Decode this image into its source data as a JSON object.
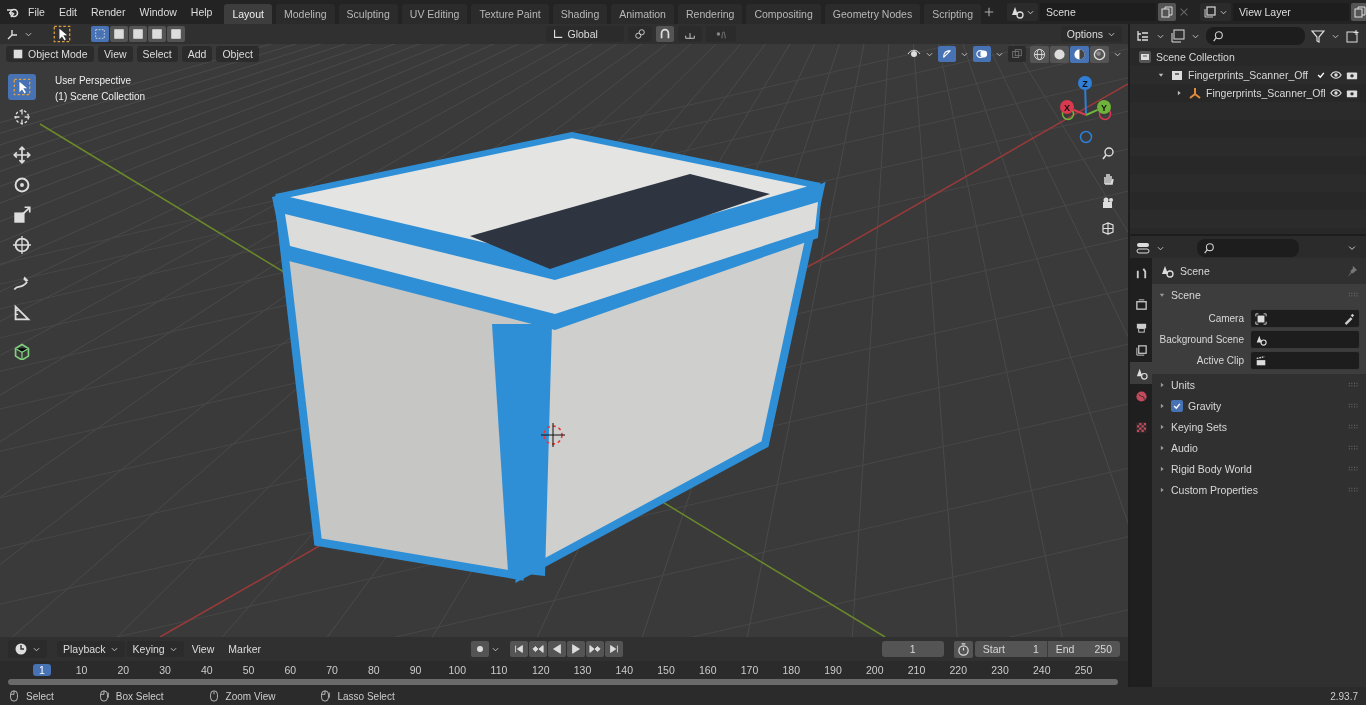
{
  "top_menu": [
    "File",
    "Edit",
    "Render",
    "Window",
    "Help"
  ],
  "workspaces": [
    {
      "label": "Layout",
      "selected": true
    },
    {
      "label": "Modeling",
      "selected": false
    },
    {
      "label": "Sculpting",
      "selected": false
    },
    {
      "label": "UV Editing",
      "selected": false
    },
    {
      "label": "Texture Paint",
      "selected": false
    },
    {
      "label": "Shading",
      "selected": false
    },
    {
      "label": "Animation",
      "selected": false
    },
    {
      "label": "Rendering",
      "selected": false
    },
    {
      "label": "Compositing",
      "selected": false
    },
    {
      "label": "Geometry Nodes",
      "selected": false
    },
    {
      "label": "Scripting",
      "selected": false
    }
  ],
  "scene_selector": {
    "value": "Scene"
  },
  "view_layer_selector": {
    "value": "View Layer"
  },
  "tool_header": {
    "proportional_edit_on": false,
    "select_modes": [
      {
        "selected": true
      },
      {
        "selected": false
      },
      {
        "selected": false
      },
      {
        "selected": false
      },
      {
        "selected": false
      }
    ],
    "orientation": "Global",
    "options": "Options"
  },
  "viewport_header": {
    "mode": "Object Mode",
    "menus": [
      "View",
      "Select",
      "Add",
      "Object"
    ],
    "gizmos_on": true,
    "overlays_on": true,
    "shading": [
      {
        "kind": "wireframe",
        "selected": false
      },
      {
        "kind": "solid",
        "selected": false
      },
      {
        "kind": "material",
        "selected": true
      },
      {
        "kind": "rendered",
        "selected": false
      }
    ]
  },
  "toolbar": [
    {
      "kind": "select",
      "selected": true
    },
    {
      "kind": "cursor",
      "selected": false
    },
    {
      "kind": "move",
      "selected": false
    },
    {
      "kind": "rotate",
      "selected": false
    },
    {
      "kind": "scale",
      "selected": false
    },
    {
      "kind": "transform",
      "selected": false
    },
    {
      "kind": "annotate",
      "selected": false
    },
    {
      "kind": "measure",
      "selected": false
    },
    {
      "kind": "add_cube",
      "selected": false
    }
  ],
  "viewport_overlay": {
    "perspective": "User Perspective",
    "collection": "(1) Scene Collection"
  },
  "gizmo_axes": [
    {
      "kind": "z",
      "label": "Z"
    },
    {
      "kind": "y",
      "label": "Y"
    },
    {
      "kind": "x",
      "label": "X"
    }
  ],
  "outliner": {
    "items": [
      {
        "kind": "scene_collection",
        "label": "Scene Collection",
        "children": [
          {
            "kind": "collection",
            "label": "Fingerprints_Scanner_Off",
            "expanded": true,
            "checked": true,
            "children": [
              {
                "kind": "object",
                "label": "Fingerprints_Scanner_Ofl",
                "expanded": false
              }
            ]
          }
        ]
      }
    ]
  },
  "properties": {
    "tabs": [
      {
        "kind": "tool",
        "selected": false
      },
      {
        "kind": "render",
        "selected": false
      },
      {
        "kind": "output",
        "selected": false
      },
      {
        "kind": "view_layer",
        "selected": false
      },
      {
        "kind": "scene",
        "selected": true
      },
      {
        "kind": "world",
        "selected": false
      },
      {
        "kind": "texture",
        "selected": false
      }
    ],
    "context": "Scene",
    "panels": [
      {
        "title": "Scene",
        "expanded": true,
        "fields": [
          {
            "label": "Camera",
            "kind": "camera"
          },
          {
            "label": "Background Scene",
            "kind": "scene"
          },
          {
            "label": "Active Clip",
            "kind": "clip"
          }
        ]
      },
      {
        "title": "Units",
        "expanded": false
      },
      {
        "title": "Gravity",
        "expanded": false,
        "checked": true
      },
      {
        "title": "Keying Sets",
        "expanded": false
      },
      {
        "title": "Audio",
        "expanded": false
      },
      {
        "title": "Rigid Body World",
        "expanded": false
      },
      {
        "title": "Custom Properties",
        "expanded": false
      }
    ]
  },
  "timeline": {
    "menus": [
      {
        "label": "Playback",
        "dropdown": true
      },
      {
        "label": "Keying",
        "dropdown": true
      },
      {
        "label": "View",
        "dropdown": false
      },
      {
        "label": "Marker",
        "dropdown": false
      }
    ],
    "current_frame": "1",
    "start_label": "Start",
    "start": "1",
    "end_label": "End",
    "end": "250",
    "ruler": [
      "1",
      "10",
      "20",
      "30",
      "40",
      "50",
      "60",
      "70",
      "80",
      "90",
      "100",
      "110",
      "120",
      "130",
      "140",
      "150",
      "160",
      "170",
      "180",
      "190",
      "200",
      "210",
      "220",
      "230",
      "240",
      "250"
    ]
  },
  "status_bar": {
    "hints": [
      {
        "kind": "left",
        "label": "Select"
      },
      {
        "kind": "drag",
        "label": "Box Select"
      },
      {
        "kind": "middle",
        "label": "Zoom View"
      },
      {
        "kind": "drag",
        "label": "Lasso Select"
      }
    ],
    "version": "2.93.7"
  }
}
